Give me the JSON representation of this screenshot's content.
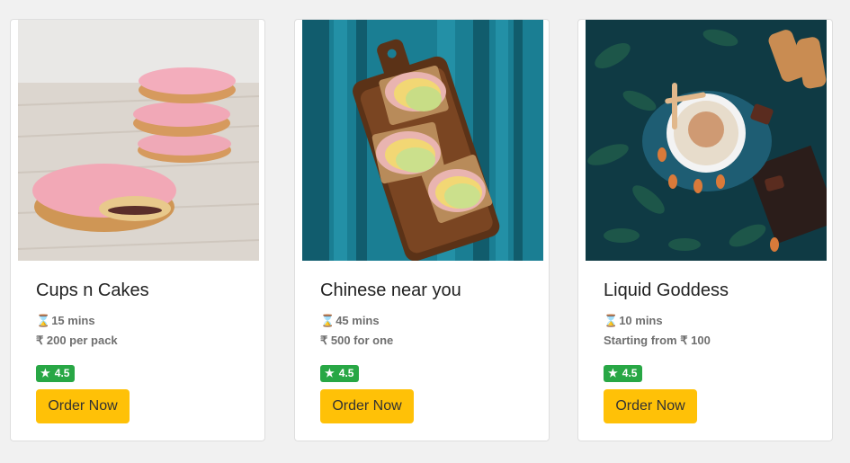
{
  "cards": [
    {
      "title": "Cups n Cakes",
      "time": "15 mins",
      "price": "₹ 200 per pack",
      "rating": "4.5",
      "button": "Order Now",
      "image": "cupcakes-photo"
    },
    {
      "title": "Chinese near you",
      "time": "45 mins",
      "price": "₹ 500 for one",
      "rating": "4.5",
      "button": "Order Now",
      "image": "sandwich-board-photo"
    },
    {
      "title": "Liquid Goddess",
      "time": "10 mins",
      "price": "Starting from ₹ 100",
      "rating": "4.5",
      "button": "Order Now",
      "image": "coffee-cup-photo"
    }
  ],
  "icons": {
    "time": "hourglass-icon",
    "rating": "star-icon"
  },
  "colors": {
    "rating_badge": "#28a745",
    "button": "#ffc107"
  }
}
